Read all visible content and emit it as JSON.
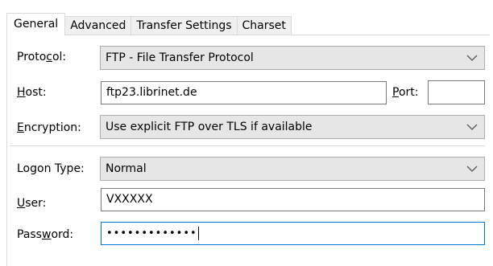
{
  "tabs": [
    {
      "label": "General",
      "active": true
    },
    {
      "label": "Advanced",
      "active": false
    },
    {
      "label": "Transfer Settings",
      "active": false
    },
    {
      "label": "Charset",
      "active": false
    }
  ],
  "protocol": {
    "label_pre": "Proto",
    "label_key": "c",
    "label_post": "ol:",
    "value": "FTP - File Transfer Protocol"
  },
  "host": {
    "label_key": "H",
    "label_post": "ost:",
    "value": "ftp23.librinet.de"
  },
  "port": {
    "label_key": "P",
    "label_post": "ort:",
    "value": ""
  },
  "encryption": {
    "label_key": "E",
    "label_post": "ncryption:",
    "value": "Use explicit FTP over TLS if available"
  },
  "logon_type": {
    "label_pre": "Logon Type:",
    "value": "Normal"
  },
  "user": {
    "label_key": "U",
    "label_post": "ser:",
    "value": "VXXXXX"
  },
  "password": {
    "label_pre": "Pass",
    "label_key": "w",
    "label_post": "ord:",
    "value": "•••••••••••••"
  },
  "icons": {
    "dropdown": "chevron-down-icon"
  },
  "colors": {
    "focus_border": "#0078d7",
    "combo_bg": "#e6e6e6"
  }
}
